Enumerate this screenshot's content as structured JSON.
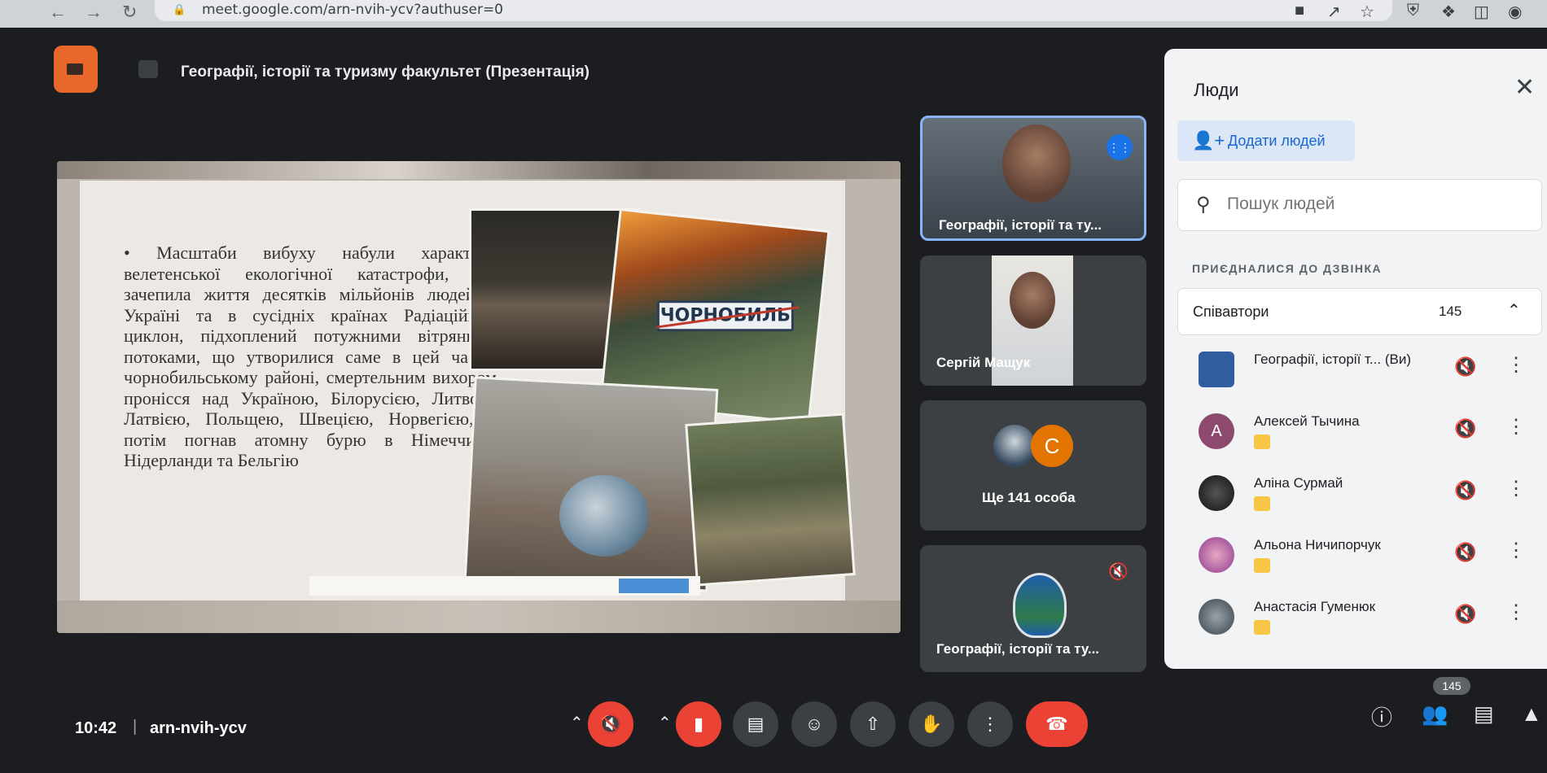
{
  "browser": {
    "url": "meet.google.com/arn-nvih-ycv?authuser=0",
    "back_icon": "arrow-left-icon",
    "forward_icon": "arrow-right-icon",
    "reload_icon": "reload-icon"
  },
  "meeting": {
    "title": "Географії, історії та туризму факультет (Презентація)",
    "time": "10:42",
    "code": "arn-nvih-ycv"
  },
  "slide": {
    "text": "• Масштаби вибуху набули характеру велетенської екологічної катастрофи, що зачепила життя десятків мільйонів людей в Україні та в сусідніх країнах Радіаційний циклон, підхоплений потужними вітряними потоками, що утворилися саме в цей час у чорнобильському районі, смертельним вихором пронісся над Україною, Білорусією, Литвою, Латвією, Польщею, Швецією, Норвегією, а потім погнав атомну бурю в Німеччину, Нідерланди та Бельгію",
    "sign_text": "ЧОРНОБИЛЬ"
  },
  "tiles": [
    {
      "name": "Географії, історії та ту..."
    },
    {
      "name": "Сергій Мащук"
    },
    {
      "name": "Ще 141 особа",
      "avatar_letter": "С"
    },
    {
      "name": "Географії, історії та ту..."
    }
  ],
  "people_panel": {
    "title": "Люди",
    "add_label": "Додати людей",
    "search_placeholder": "Пошук людей",
    "section_label": "ПРИЄДНАЛИСЯ ДО ДЗВІНКА",
    "group_label": "Співавтори",
    "group_count": "145",
    "members": [
      {
        "name": "Географії, історії т...",
        "suffix": "(Ви)",
        "avatar_letter": ""
      },
      {
        "name": "Алексей Тычина",
        "suffix": "",
        "avatar_letter": "А"
      },
      {
        "name": "Аліна Сурмай",
        "suffix": "",
        "avatar_letter": ""
      },
      {
        "name": "Альона Ничипорчук",
        "suffix": "",
        "avatar_letter": ""
      },
      {
        "name": "Анастасія Гуменюк",
        "suffix": "",
        "avatar_letter": ""
      }
    ]
  },
  "controls": {
    "participants_count": "145"
  },
  "colors": {
    "end_call": "#ea4335",
    "accent": "#1a73e8",
    "meet_logo": "#e8672b"
  }
}
